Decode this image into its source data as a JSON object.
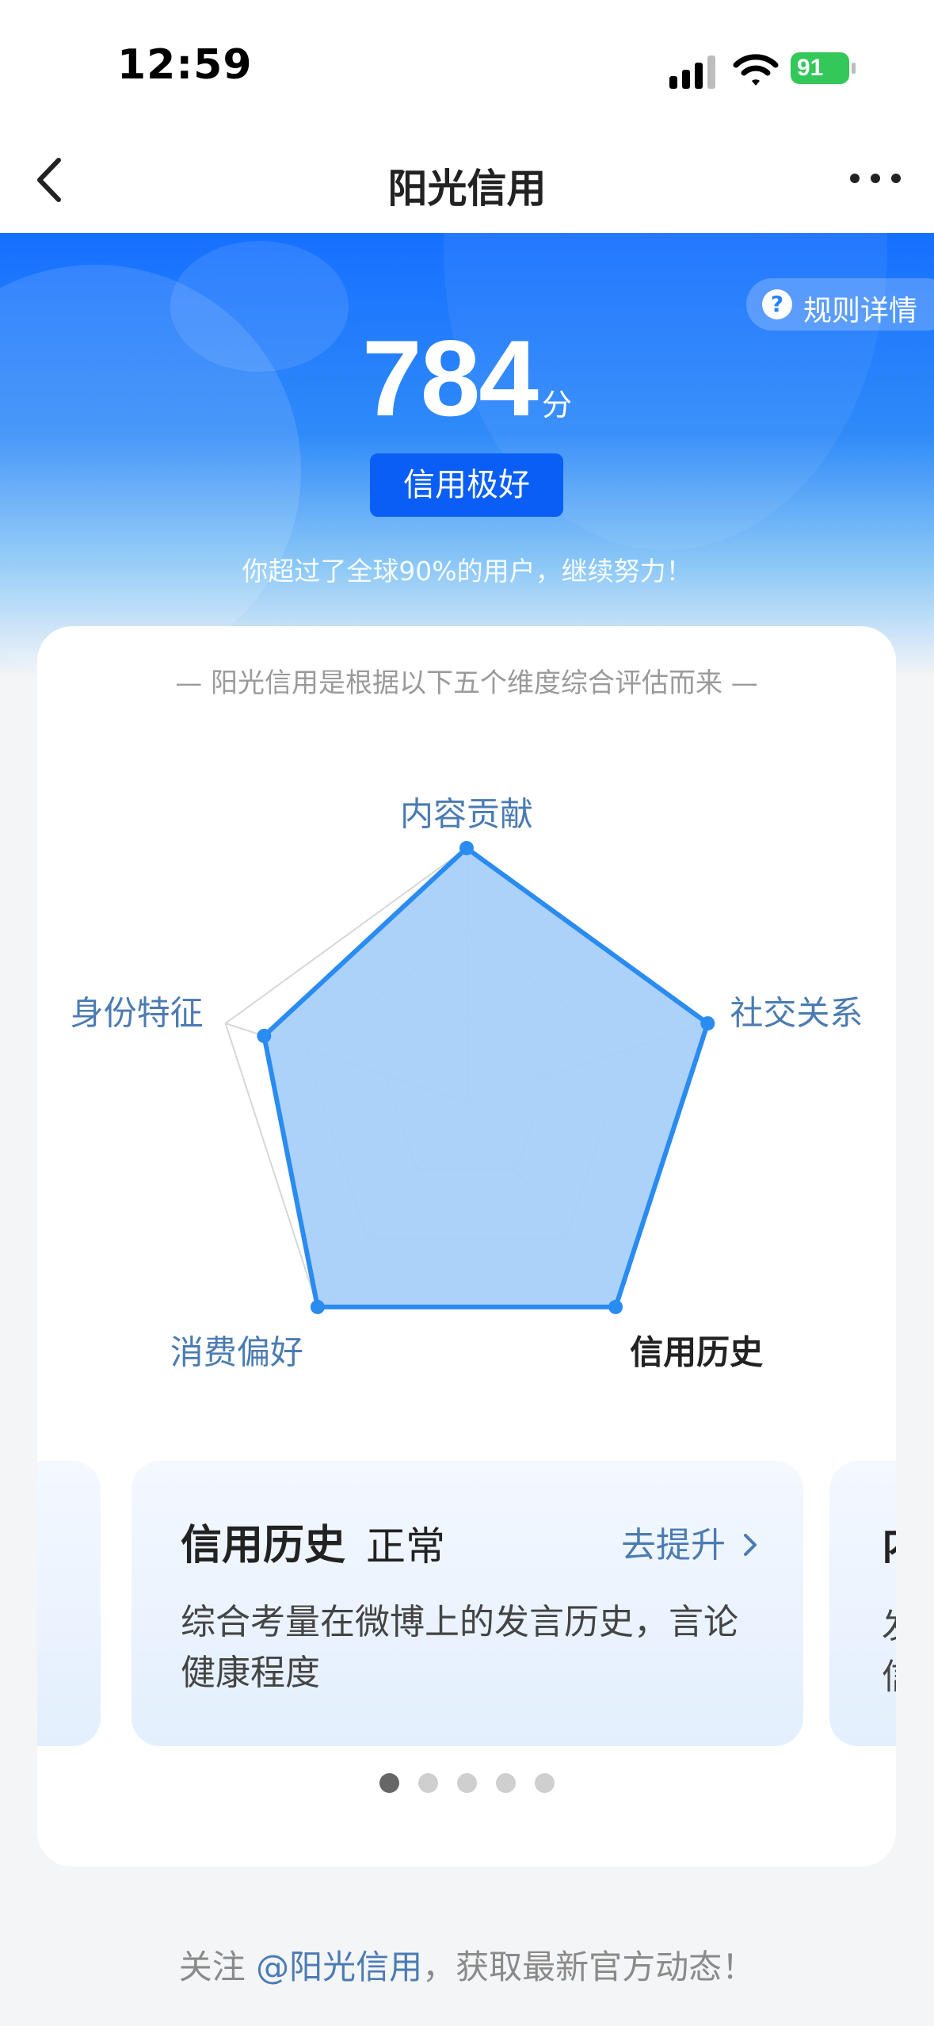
{
  "status_bar": {
    "time": "12:59",
    "battery": "91"
  },
  "nav": {
    "title": "阳光信用"
  },
  "hero": {
    "rules_label": "规则详情",
    "score": "784",
    "score_unit": "分",
    "level": "信用极好",
    "exceed_text": "你超过了全球90%的用户，继续努力！"
  },
  "card": {
    "subtitle": "— 阳光信用是根据以下五个维度综合评估而来 —",
    "radar": {
      "dimensions": [
        "内容贡献",
        "社交关系",
        "信用历史",
        "消费偏好",
        "身份特征"
      ],
      "active_dimension": "信用历史",
      "values": [
        1.0,
        1.0,
        1.0,
        1.0,
        0.84
      ],
      "colors": {
        "fill": "#a8d0fa",
        "stroke": "#2a8bf0",
        "grid": "#d7d7d7",
        "label": "#4b7bb2",
        "active_label": "#222222"
      }
    },
    "carousel": {
      "current": {
        "title": "信用历史",
        "status": "正常",
        "action": "去提升",
        "description": "综合考量在微博上的发言历史，言论健康程度"
      },
      "next_peek": {
        "title": "内",
        "desc_line1": "发",
        "desc_line2": "信"
      },
      "dot_count": 5,
      "active_index": 0
    }
  },
  "footer": {
    "prefix": "关注 ",
    "mention": "@阳光信用",
    "suffix": "，获取最新官方动态！"
  }
}
